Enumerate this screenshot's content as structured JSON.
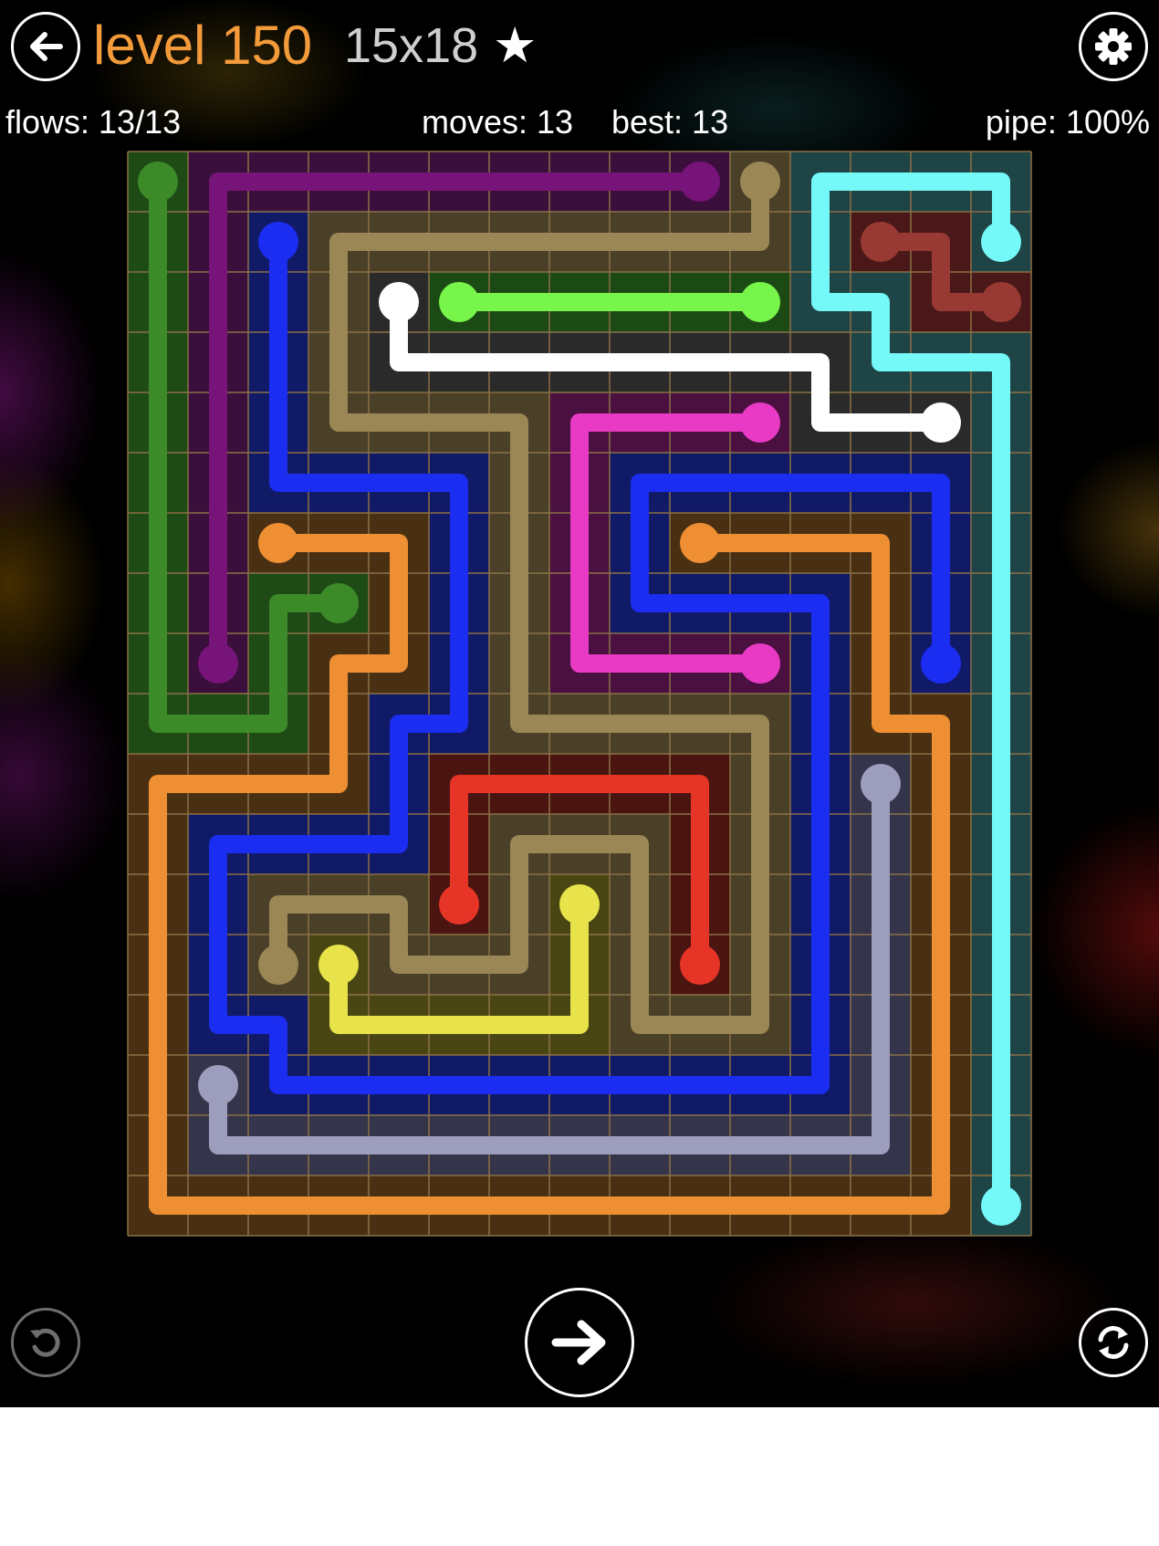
{
  "header": {
    "level_label": "level 150",
    "size_label": "15x18",
    "star_glyph": "★"
  },
  "stats": {
    "flows": "flows: 13/13",
    "moves": "moves: 13",
    "best": "best: 13",
    "pipe": "pipe: 100%"
  },
  "icons": {
    "back": "back-arrow-icon",
    "settings": "gear-icon",
    "undo": "undo-icon",
    "next": "next-arrow-icon",
    "refresh": "refresh-icon"
  },
  "grid": {
    "cols": 15,
    "rows": 18,
    "line_color": "#8a7046"
  },
  "colors": {
    "accent_orange": "#f39a3a",
    "background": "#000000"
  },
  "flows": [
    {
      "name": "green",
      "color": "#3c8a28",
      "tint": "#1e4a16",
      "path": [
        [
          0,
          0
        ],
        [
          0,
          9
        ],
        [
          2,
          9
        ],
        [
          2,
          7
        ],
        [
          3,
          7
        ]
      ]
    },
    {
      "name": "purple",
      "color": "#771479",
      "tint": "#3a0f3c",
      "path": [
        [
          9,
          0
        ],
        [
          1,
          0
        ],
        [
          1,
          8
        ]
      ]
    },
    {
      "name": "tan",
      "color": "#9b8756",
      "tint": "#4a4028",
      "path": [
        [
          10,
          0
        ],
        [
          10,
          1
        ],
        [
          3,
          1
        ],
        [
          3,
          4
        ],
        [
          6,
          4
        ],
        [
          6,
          9
        ],
        [
          10,
          9
        ],
        [
          10,
          14
        ],
        [
          8,
          14
        ],
        [
          8,
          11
        ],
        [
          6,
          11
        ],
        [
          6,
          13
        ],
        [
          4,
          13
        ],
        [
          4,
          12
        ],
        [
          2,
          12
        ],
        [
          2,
          13
        ]
      ]
    },
    {
      "name": "cyan",
      "color": "#75f8f8",
      "tint": "#1e4446",
      "path": [
        [
          14,
          1
        ],
        [
          14,
          0
        ],
        [
          11,
          0
        ],
        [
          11,
          2
        ],
        [
          12,
          2
        ],
        [
          12,
          3
        ],
        [
          14,
          3
        ],
        [
          14,
          17
        ]
      ]
    },
    {
      "name": "blue",
      "color": "#1a2df0",
      "tint": "#101a66",
      "path": [
        [
          2,
          1
        ],
        [
          2,
          5
        ],
        [
          5,
          5
        ],
        [
          5,
          9
        ],
        [
          4,
          9
        ],
        [
          4,
          11
        ],
        [
          1,
          11
        ],
        [
          1,
          14
        ],
        [
          2,
          14
        ],
        [
          2,
          15
        ],
        [
          11,
          15
        ],
        [
          11,
          7
        ],
        [
          8,
          7
        ],
        [
          8,
          5
        ],
        [
          13,
          5
        ],
        [
          13,
          8
        ]
      ]
    },
    {
      "name": "white",
      "color": "#ffffff",
      "tint": "#2a2a2a",
      "path": [
        [
          4,
          2
        ],
        [
          4,
          3
        ],
        [
          11,
          3
        ],
        [
          11,
          4
        ],
        [
          13,
          4
        ]
      ]
    },
    {
      "name": "lime",
      "color": "#78f54a",
      "tint": "#1c4a14",
      "path": [
        [
          5,
          2
        ],
        [
          10,
          2
        ]
      ]
    },
    {
      "name": "darkred",
      "color": "#983933",
      "tint": "#4a1818",
      "path": [
        [
          12,
          1
        ],
        [
          13,
          1
        ],
        [
          13,
          2
        ],
        [
          14,
          2
        ]
      ]
    },
    {
      "name": "magenta",
      "color": "#e83ac4",
      "tint": "#4a1040",
      "path": [
        [
          10,
          4
        ],
        [
          7,
          4
        ],
        [
          7,
          8
        ],
        [
          10,
          8
        ]
      ]
    },
    {
      "name": "orange",
      "color": "#ef8f33",
      "tint": "#4a3012",
      "path": [
        [
          2,
          6
        ],
        [
          4,
          6
        ],
        [
          4,
          8
        ],
        [
          3,
          8
        ],
        [
          3,
          10
        ],
        [
          0,
          10
        ],
        [
          0,
          17
        ],
        [
          13,
          17
        ],
        [
          13,
          9
        ],
        [
          12,
          9
        ],
        [
          12,
          6
        ],
        [
          9,
          6
        ]
      ]
    },
    {
      "name": "red",
      "color": "#e63526",
      "tint": "#4a1410",
      "path": [
        [
          5,
          12
        ],
        [
          5,
          10
        ],
        [
          9,
          10
        ],
        [
          9,
          13
        ]
      ]
    },
    {
      "name": "yellow",
      "color": "#e8e34a",
      "tint": "#4a4614",
      "path": [
        [
          3,
          13
        ],
        [
          3,
          14
        ],
        [
          7,
          14
        ],
        [
          7,
          12
        ]
      ]
    },
    {
      "name": "lavender",
      "color": "#9d9dbd",
      "tint": "#34344a",
      "path": [
        [
          1,
          15
        ],
        [
          1,
          16
        ],
        [
          12,
          16
        ],
        [
          12,
          10
        ]
      ]
    }
  ]
}
